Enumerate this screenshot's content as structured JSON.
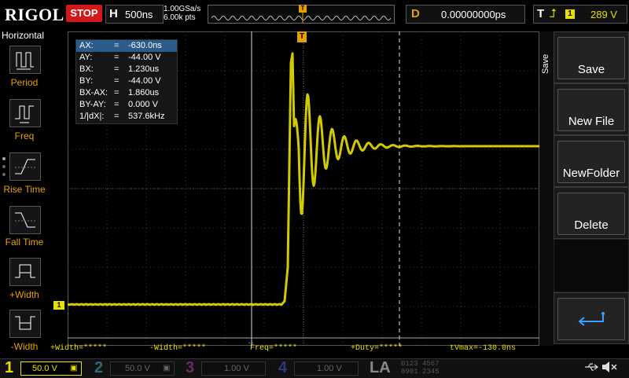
{
  "brand": {
    "logo": "RIGOL",
    "run_state": "STOP"
  },
  "timebase": {
    "label": "H",
    "scale": "500ns"
  },
  "acquisition": {
    "sample_rate": "1.00GSa/s",
    "memory_depth": "6.00k pts"
  },
  "trigger_marker": "T",
  "delay": {
    "label": "D",
    "value": "0.00000000ps"
  },
  "trigger": {
    "label": "T",
    "edge_icon": "rising-edge-icon",
    "source": "1",
    "level": "289 V"
  },
  "left_menu": {
    "title": "Horizontal",
    "items": [
      {
        "label": "Period",
        "icon": "period-icon"
      },
      {
        "label": "Freq",
        "icon": "freq-icon"
      },
      {
        "label": "Rise Time",
        "icon": "rise-time-icon"
      },
      {
        "label": "Fall Time",
        "icon": "fall-time-icon"
      },
      {
        "label": "+Width",
        "icon": "pos-width-icon"
      },
      {
        "label": "-Width",
        "icon": "neg-width-icon"
      }
    ]
  },
  "cursors": [
    {
      "name": "AX:",
      "eq": "=",
      "value": "-630.0ns"
    },
    {
      "name": "AY:",
      "eq": "=",
      "value": "-44.00 V"
    },
    {
      "name": "BX:",
      "eq": "=",
      "value": "1.230us"
    },
    {
      "name": "BY:",
      "eq": "=",
      "value": "-44.00 V"
    },
    {
      "name": "BX-AX:",
      "eq": "=",
      "value": "1.860us"
    },
    {
      "name": "BY-AY:",
      "eq": "=",
      "value": "0.000 V"
    },
    {
      "name": "1/|dX|:",
      "eq": "=",
      "value": "537.6kHz"
    }
  ],
  "channel_marker": "1",
  "measurements": {
    "pos_width": "+Width=*****",
    "neg_width": "-Width=*****",
    "freq": "Freq=*****",
    "duty": "+Duty=*****",
    "tvmax": "tVmax=-130.0ns"
  },
  "right_menu": {
    "title": "Save",
    "buttons": [
      "Save",
      "New File",
      "NewFolder",
      "Delete"
    ],
    "enter_icon": "enter-icon"
  },
  "channels": [
    {
      "num": "1",
      "scale": "50.0 V",
      "color": "#e8e000"
    },
    {
      "num": "2",
      "scale": "50.0 V",
      "color": "#2fb8c8"
    },
    {
      "num": "3",
      "scale": "1.00 V",
      "color": "#c040c0"
    },
    {
      "num": "4",
      "scale": "1.00 V",
      "color": "#3070e0"
    }
  ],
  "la": {
    "label": "LA",
    "digits_top": "0123 4567",
    "digits_bottom": "8901 2345"
  },
  "status_icons": [
    "usb-icon",
    "speaker-muted-icon"
  ],
  "colors": {
    "ch1": "#e8e000",
    "accent": "#e8a000",
    "stop": "#d21919"
  }
}
